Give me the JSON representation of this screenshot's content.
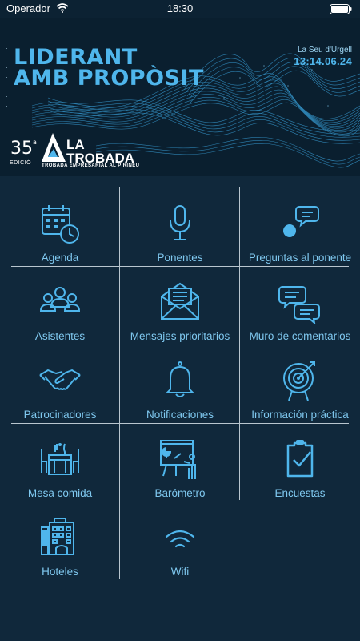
{
  "status_bar": {
    "carrier": "Operador",
    "time": "18:30"
  },
  "banner": {
    "title_line1": "LIDERANT",
    "title_line2": "AMB PROPÒSIT",
    "location": "La Seu d'Urgell",
    "dates": "13:14.06.24",
    "edition_number": "35",
    "edition_sup": "a",
    "edition_label": "EDICIÓ",
    "brand_line1": "LA",
    "brand_line2": "TROBADA",
    "brand_subtitle": "TROBADA EMPRESARIAL AL PIRINEU"
  },
  "menu": [
    {
      "label": "Agenda",
      "icon": "calendar-clock-icon"
    },
    {
      "label": "Ponentes",
      "icon": "microphone-icon"
    },
    {
      "label": "Preguntas al ponente",
      "icon": "question-bubble-icon"
    },
    {
      "label": "Asistentes",
      "icon": "group-people-icon"
    },
    {
      "label": "Mensajes prioritarios",
      "icon": "envelope-icon"
    },
    {
      "label": "Muro de comentarios",
      "icon": "chat-bubbles-icon"
    },
    {
      "label": "Patrocinadores",
      "icon": "handshake-icon"
    },
    {
      "label": "Notificaciones",
      "icon": "bell-icon"
    },
    {
      "label": "Información práctica",
      "icon": "target-icon"
    },
    {
      "label": "Mesa comida",
      "icon": "dining-table-icon"
    },
    {
      "label": "Barómetro",
      "icon": "presentation-board-icon"
    },
    {
      "label": "Encuestas",
      "icon": "clipboard-check-icon"
    },
    {
      "label": "Hoteles",
      "icon": "hotel-icon"
    },
    {
      "label": "Wifi",
      "icon": "wifi-icon"
    }
  ],
  "colors": {
    "background": "#10283b",
    "accent": "#4fb6ec",
    "label": "#7fc8ef",
    "grid_line": "#b9c6cf"
  }
}
